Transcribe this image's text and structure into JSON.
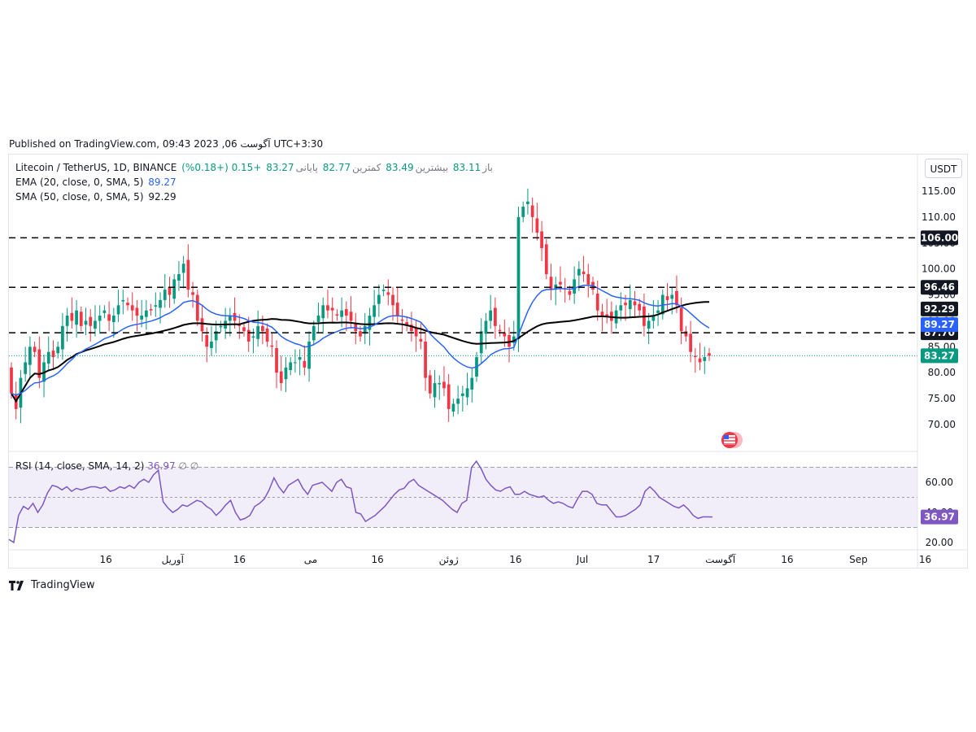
{
  "header": {
    "published": "Published on TradingView.com, 09:43 2023 ,06 آگوست UTC+3:30"
  },
  "legend": {
    "symbol": "Litecoin / TetherUS, 1D, BINANCE",
    "open_label": "باز",
    "open": "83.11",
    "high_label": "بیشترین",
    "high": "83.49",
    "low_label": "کمترین",
    "low": "82.77",
    "close_label": "پایانی",
    "close": "83.27",
    "change": "+0.15 (+0.18%)",
    "ema_label": "EMA (20, close, 0, SMA, 5)",
    "ema_value": "89.27",
    "sma_label": "SMA (50, close, 0, SMA, 5)",
    "sma_value": "92.29",
    "rsi_label": "RSI (14, close, SMA, 14, 2)",
    "rsi_value": "36.97",
    "rsi_extra": "∅ ∅"
  },
  "currency": "USDT",
  "footer": {
    "brand": "TradingView"
  },
  "colors": {
    "up": "#089981",
    "down": "#f23645",
    "ema": "#2962ff",
    "sma": "#000000",
    "rsi": "#7e57c2",
    "rsi_band": "#7e57c2",
    "last_price": "#089981"
  },
  "chart_data": [
    {
      "type": "candlestick",
      "title": "Litecoin / TetherUS, 1D, BINANCE",
      "ylim": [
        65.5,
        118
      ],
      "y_ticks": [
        70,
        75,
        80,
        85,
        90,
        95,
        100,
        105,
        110,
        115
      ],
      "y_tick_labels": [
        "70.00",
        "75.00",
        "80.00",
        "85.00",
        "90.00",
        "95.00",
        "100.00",
        "105.00",
        "110.00",
        "115.00"
      ],
      "x_tick_labels": [
        "16",
        "آوریل",
        "16",
        "می",
        "16",
        "ژوئن",
        "16",
        "Jul",
        "17",
        "آگوست",
        "16",
        "Sep",
        "16"
      ],
      "x_tick_days": [
        15,
        30,
        45,
        61,
        76,
        92,
        107,
        122,
        138,
        153,
        168,
        184,
        199
      ],
      "x_range_days": [
        0,
        202
      ],
      "horizontal_levels": [
        {
          "value": 106.0,
          "label": "106.00",
          "style": "dashed"
        },
        {
          "value": 96.46,
          "label": "96.46",
          "style": "dashed"
        },
        {
          "value": 87.7,
          "label": "87.70",
          "style": "dashed"
        }
      ],
      "price_labels": [
        {
          "value": 92.29,
          "label": "92.29",
          "kind": "sma"
        },
        {
          "value": 89.27,
          "label": "89.27",
          "kind": "ema"
        },
        {
          "value": 83.27,
          "label": "83.27",
          "kind": "last"
        }
      ],
      "closes": [
        76,
        73,
        79,
        82,
        85,
        84,
        79,
        82,
        84,
        83,
        85,
        89,
        91,
        90,
        92,
        89,
        90,
        89,
        90,
        91,
        92,
        90,
        91,
        93,
        94,
        93,
        92,
        91,
        91,
        92,
        92,
        93,
        94,
        96,
        95,
        98,
        99,
        101,
        96,
        95,
        90,
        88,
        85,
        86,
        88,
        89,
        90,
        91,
        90,
        89,
        88,
        86,
        87,
        89,
        88,
        86,
        85,
        80,
        78,
        81,
        82,
        82,
        83,
        81,
        86,
        89,
        91,
        93,
        92,
        92,
        91,
        92,
        91,
        90,
        88,
        87,
        89,
        91,
        93,
        95,
        96,
        95,
        93,
        91,
        90,
        89,
        88,
        87,
        86,
        79,
        76,
        78,
        78,
        77,
        73,
        74,
        75,
        76,
        77,
        79,
        83,
        88,
        90,
        92,
        89,
        88,
        87,
        85,
        87,
        110,
        112,
        113,
        110,
        107,
        104,
        99,
        96,
        97,
        97,
        96,
        95,
        98,
        100,
        99,
        97,
        96,
        92,
        91,
        91,
        90,
        92,
        93,
        93,
        94,
        93,
        92,
        89,
        90,
        91,
        92,
        95,
        94,
        95,
        93,
        88,
        87,
        84,
        83,
        82,
        83,
        83.27
      ],
      "ema": {
        "name": "EMA (20, close, 0, SMA, 5)",
        "last": 89.27
      },
      "sma": {
        "name": "SMA (50, close, 0, SMA, 5)",
        "last": 92.29
      }
    },
    {
      "type": "line",
      "title": "RSI (14, close, SMA, 14, 2)",
      "ylim": [
        16,
        80
      ],
      "y_ticks": [
        20,
        40,
        60
      ],
      "y_tick_labels": [
        "20.00",
        "40.00",
        "60.00"
      ],
      "band": [
        30,
        70
      ],
      "midline": 50,
      "last_label": "36.97",
      "values": [
        22,
        20,
        38,
        44,
        42,
        46,
        40,
        45,
        53,
        58,
        57,
        55,
        57,
        54,
        56,
        55,
        56,
        57,
        57,
        56,
        57,
        54,
        55,
        57,
        56,
        58,
        56,
        60,
        62,
        60,
        65,
        68,
        47,
        43,
        40,
        42,
        45,
        44,
        46,
        48,
        47,
        44,
        42,
        38,
        41,
        45,
        48,
        40,
        35,
        36,
        38,
        44,
        46,
        49,
        55,
        63,
        57,
        53,
        58,
        60,
        62,
        56,
        52,
        58,
        59,
        60,
        57,
        54,
        60,
        62,
        57,
        56,
        40,
        39,
        34,
        36,
        38,
        41,
        44,
        48,
        52,
        55,
        56,
        60,
        62,
        58,
        56,
        54,
        52,
        50,
        48,
        45,
        42,
        40,
        46,
        48,
        70,
        74,
        69,
        62,
        58,
        55,
        54,
        56,
        57,
        52,
        52,
        54,
        52,
        51,
        50,
        51,
        48,
        46,
        47,
        46,
        44,
        43,
        49,
        54,
        54,
        52,
        46,
        45,
        45,
        41,
        37,
        37,
        38,
        40,
        42,
        45,
        54,
        57,
        54,
        50,
        48,
        46,
        44,
        43,
        45,
        42,
        38,
        36,
        37,
        37,
        36.97
      ]
    }
  ]
}
